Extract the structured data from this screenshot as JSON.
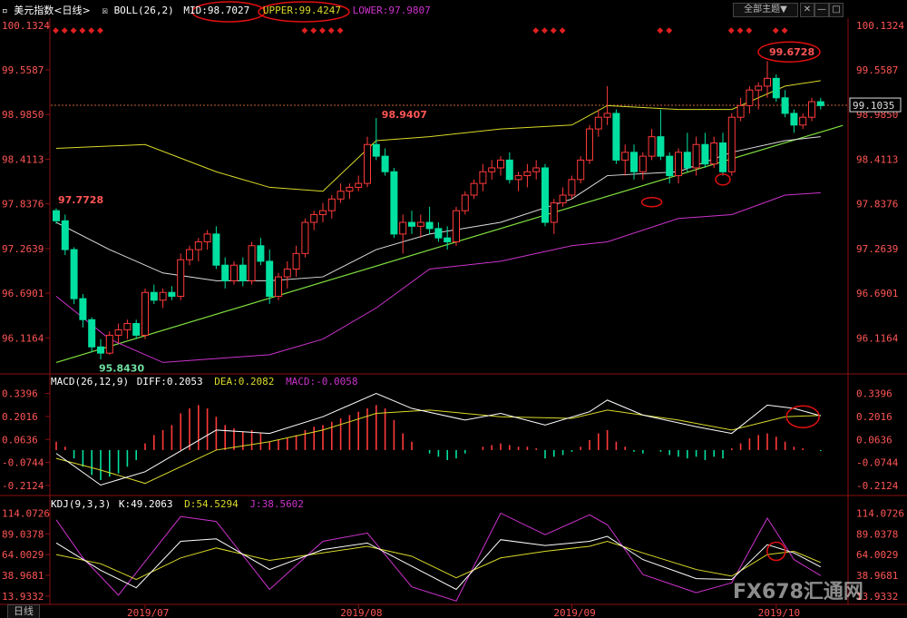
{
  "header": {
    "symbol_label": "美元指数<日线>",
    "boll_label": "BOLL(26,2)",
    "mid_label": "MID:98.7027",
    "upper_label": "UPPER:99.4247",
    "lower_label": "LOWER:97.9807",
    "theme_select": "全部主题▼",
    "theme_options": [
      "全部主题"
    ]
  },
  "panels": {
    "macd_label": "MACD(26,12,9)",
    "macd_diff": "DIFF:0.2053",
    "macd_dea": "DEA:0.2082",
    "macd_macd": "MACD:-0.0058",
    "kdj_label": "KDJ(9,3,3)",
    "kdj_k": "K:49.2063",
    "kdj_d": "D:54.5294",
    "kdj_j": "J:38.5602"
  },
  "bottom_bar": {
    "period_tab": "日线"
  },
  "watermark": {
    "brand": "FX678汇通网"
  },
  "colors": {
    "up": "#ff3a3a",
    "down": "#00e0a0",
    "boll_upper": "#d9d92a",
    "boll_mid": "#dddddd",
    "boll_lower": "#cc33cc",
    "trendline": "#80e040",
    "axis": "#8b1010",
    "tick_text": "#ff5555",
    "price_line": "#c86432",
    "highlight_ellipse": "#e01010"
  },
  "chart_data": [
    {
      "type": "candlestick",
      "title": "美元指数<日线>",
      "y_ticks": [
        "100.1324",
        "99.5587",
        "98.9850",
        "98.4113",
        "97.8376",
        "97.2639",
        "96.6901",
        "96.1164"
      ],
      "ylim": [
        95.7,
        100.2
      ],
      "x_ticks": [
        "2019/07",
        "2019/08",
        "2019/09",
        "2019/10"
      ],
      "last_price": "99.1035",
      "candles": [
        [
          97.75,
          97.78,
          97.58,
          97.62
        ],
        [
          97.62,
          97.7,
          97.18,
          97.25
        ],
        [
          97.25,
          97.28,
          96.55,
          96.62
        ],
        [
          96.62,
          96.68,
          96.25,
          96.35
        ],
        [
          96.35,
          96.38,
          95.93,
          96.0
        ],
        [
          96.0,
          96.1,
          95.84,
          95.92
        ],
        [
          95.92,
          96.2,
          95.9,
          96.15
        ],
        [
          96.15,
          96.3,
          96.05,
          96.22
        ],
        [
          96.22,
          96.35,
          96.1,
          96.3
        ],
        [
          96.3,
          96.35,
          96.1,
          96.15
        ],
        [
          96.15,
          96.75,
          96.1,
          96.7
        ],
        [
          96.7,
          96.8,
          96.55,
          96.6
        ],
        [
          96.6,
          96.75,
          96.5,
          96.7
        ],
        [
          96.7,
          96.78,
          96.6,
          96.65
        ],
        [
          96.65,
          97.2,
          96.6,
          97.12
        ],
        [
          97.12,
          97.3,
          97.05,
          97.25
        ],
        [
          97.25,
          97.4,
          97.1,
          97.35
        ],
        [
          97.35,
          97.5,
          97.25,
          97.45
        ],
        [
          97.45,
          97.55,
          97.0,
          97.05
        ],
        [
          97.05,
          97.15,
          96.75,
          96.85
        ],
        [
          96.85,
          97.1,
          96.8,
          97.05
        ],
        [
          97.05,
          97.15,
          96.78,
          96.85
        ],
        [
          96.85,
          97.35,
          96.8,
          97.3
        ],
        [
          97.3,
          97.4,
          97.05,
          97.1
        ],
        [
          97.1,
          97.25,
          96.55,
          96.65
        ],
        [
          96.65,
          96.95,
          96.6,
          96.9
        ],
        [
          96.9,
          97.1,
          96.75,
          97.0
        ],
        [
          97.0,
          97.3,
          96.9,
          97.2
        ],
        [
          97.2,
          97.65,
          97.15,
          97.6
        ],
        [
          97.6,
          97.75,
          97.5,
          97.7
        ],
        [
          97.7,
          97.85,
          97.6,
          97.75
        ],
        [
          97.75,
          97.95,
          97.65,
          97.9
        ],
        [
          97.9,
          98.1,
          97.85,
          98.0
        ],
        [
          98.0,
          98.1,
          97.9,
          98.05
        ],
        [
          98.05,
          98.2,
          98.0,
          98.1
        ],
        [
          98.1,
          98.7,
          98.05,
          98.6
        ],
        [
          98.6,
          98.94,
          98.4,
          98.45
        ],
        [
          98.45,
          98.55,
          98.2,
          98.25
        ],
        [
          98.25,
          98.3,
          97.4,
          97.45
        ],
        [
          97.45,
          97.7,
          97.2,
          97.6
        ],
        [
          97.6,
          97.75,
          97.45,
          97.55
        ],
        [
          97.55,
          97.7,
          97.4,
          97.6
        ],
        [
          97.6,
          97.8,
          97.45,
          97.52
        ],
        [
          97.52,
          97.6,
          97.35,
          97.4
        ],
        [
          97.4,
          97.55,
          97.25,
          97.35
        ],
        [
          97.35,
          97.8,
          97.3,
          97.75
        ],
        [
          97.75,
          98.0,
          97.7,
          97.95
        ],
        [
          97.95,
          98.15,
          97.9,
          98.1
        ],
        [
          98.1,
          98.35,
          98.0,
          98.25
        ],
        [
          98.25,
          98.4,
          98.15,
          98.3
        ],
        [
          98.3,
          98.45,
          98.2,
          98.4
        ],
        [
          98.4,
          98.5,
          98.1,
          98.15
        ],
        [
          98.15,
          98.25,
          98.0,
          98.2
        ],
        [
          98.2,
          98.35,
          98.05,
          98.25
        ],
        [
          98.25,
          98.4,
          98.15,
          98.3
        ],
        [
          98.3,
          98.35,
          97.55,
          97.6
        ],
        [
          97.6,
          97.9,
          97.45,
          97.85
        ],
        [
          97.85,
          98.05,
          97.8,
          97.95
        ],
        [
          97.95,
          98.2,
          97.9,
          98.15
        ],
        [
          98.15,
          98.45,
          98.1,
          98.4
        ],
        [
          98.4,
          98.85,
          98.35,
          98.8
        ],
        [
          98.8,
          99.05,
          98.7,
          98.95
        ],
        [
          98.95,
          99.35,
          98.85,
          99.0
        ],
        [
          99.0,
          99.05,
          98.35,
          98.4
        ],
        [
          98.4,
          98.6,
          98.2,
          98.5
        ],
        [
          98.5,
          98.6,
          98.15,
          98.25
        ],
        [
          98.25,
          98.5,
          98.15,
          98.45
        ],
        [
          98.45,
          98.8,
          98.4,
          98.7
        ],
        [
          98.7,
          99.05,
          98.4,
          98.45
        ],
        [
          98.45,
          98.5,
          98.1,
          98.2
        ],
        [
          98.2,
          98.55,
          98.1,
          98.5
        ],
        [
          98.5,
          98.75,
          98.25,
          98.3
        ],
        [
          98.3,
          98.7,
          98.2,
          98.6
        ],
        [
          98.6,
          98.75,
          98.3,
          98.35
        ],
        [
          98.35,
          98.7,
          98.3,
          98.62
        ],
        [
          98.62,
          98.75,
          98.2,
          98.25
        ],
        [
          98.25,
          99.0,
          98.2,
          98.95
        ],
        [
          98.95,
          99.2,
          98.9,
          99.1
        ],
        [
          99.1,
          99.35,
          99.0,
          99.3
        ],
        [
          99.3,
          99.4,
          99.05,
          99.35
        ],
        [
          99.35,
          99.67,
          99.2,
          99.45
        ],
        [
          99.45,
          99.5,
          99.15,
          99.2
        ],
        [
          99.2,
          99.3,
          98.95,
          99.0
        ],
        [
          99.0,
          99.05,
          98.75,
          98.85
        ],
        [
          98.85,
          99.0,
          98.8,
          98.95
        ],
        [
          98.95,
          99.2,
          98.9,
          99.15
        ],
        [
          99.15,
          99.2,
          99.05,
          99.1
        ]
      ],
      "boll_upper": [
        [
          0,
          98.55
        ],
        [
          10,
          98.6
        ],
        [
          18,
          98.25
        ],
        [
          24,
          98.05
        ],
        [
          30,
          98.0
        ],
        [
          36,
          98.65
        ],
        [
          42,
          98.7
        ],
        [
          50,
          98.8
        ],
        [
          58,
          98.85
        ],
        [
          62,
          99.1
        ],
        [
          70,
          99.05
        ],
        [
          76,
          99.05
        ],
        [
          82,
          99.35
        ],
        [
          86,
          99.42
        ]
      ],
      "boll_mid": [
        [
          0,
          97.6
        ],
        [
          6,
          97.25
        ],
        [
          12,
          96.95
        ],
        [
          18,
          96.85
        ],
        [
          24,
          96.85
        ],
        [
          30,
          96.9
        ],
        [
          36,
          97.25
        ],
        [
          42,
          97.45
        ],
        [
          50,
          97.6
        ],
        [
          58,
          97.9
        ],
        [
          62,
          98.2
        ],
        [
          70,
          98.25
        ],
        [
          76,
          98.5
        ],
        [
          82,
          98.65
        ],
        [
          86,
          98.7
        ]
      ],
      "boll_lower": [
        [
          0,
          96.65
        ],
        [
          6,
          96.1
        ],
        [
          12,
          95.8
        ],
        [
          18,
          95.85
        ],
        [
          24,
          95.9
        ],
        [
          30,
          96.1
        ],
        [
          36,
          96.5
        ],
        [
          42,
          97.0
        ],
        [
          50,
          97.1
        ],
        [
          58,
          97.3
        ],
        [
          62,
          97.35
        ],
        [
          70,
          97.65
        ],
        [
          76,
          97.7
        ],
        [
          82,
          97.95
        ],
        [
          86,
          97.98
        ]
      ],
      "trendline": [
        [
          0,
          95.8
        ],
        [
          86,
          98.76
        ]
      ],
      "annotations": [
        {
          "text": "97.7728",
          "at": [
            0,
            97.7728
          ]
        },
        {
          "text": "95.8430",
          "at": [
            5,
            95.843
          ]
        },
        {
          "text": "98.9407",
          "at": [
            36,
            98.9407
          ]
        },
        {
          "text": "99.6728",
          "at": [
            80,
            99.6728
          ]
        }
      ],
      "signals_top": [
        0,
        1,
        2,
        3,
        4,
        5,
        28,
        29,
        30,
        31,
        32,
        54,
        55,
        56,
        57,
        68,
        69,
        76,
        77,
        78,
        81,
        82
      ]
    },
    {
      "type": "bar",
      "title": "MACD(26,12,9)",
      "y_ticks": [
        "0.3396",
        "0.2016",
        "0.0636",
        "-0.0744",
        "-0.2124"
      ],
      "ylim": [
        -0.24,
        0.37
      ],
      "histogram": [
        0.05,
        0.02,
        -0.05,
        -0.1,
        -0.15,
        -0.18,
        -0.16,
        -0.14,
        -0.1,
        -0.06,
        0.04,
        0.09,
        0.12,
        0.15,
        0.22,
        0.25,
        0.27,
        0.25,
        0.2,
        0.15,
        0.13,
        0.11,
        0.12,
        0.1,
        0.05,
        0.06,
        0.07,
        0.09,
        0.12,
        0.14,
        0.15,
        0.17,
        0.19,
        0.21,
        0.23,
        0.25,
        0.27,
        0.25,
        0.18,
        0.1,
        0.05,
        0.0,
        -0.02,
        -0.04,
        -0.06,
        -0.05,
        -0.02,
        0.0,
        0.02,
        0.03,
        0.04,
        0.03,
        0.02,
        0.02,
        0.01,
        -0.05,
        -0.04,
        -0.03,
        -0.01,
        0.02,
        0.06,
        0.1,
        0.12,
        0.05,
        0.02,
        -0.01,
        -0.02,
        0.0,
        -0.01,
        -0.03,
        -0.04,
        -0.05,
        -0.04,
        -0.06,
        -0.04,
        -0.05,
        0.01,
        0.04,
        0.07,
        0.09,
        0.1,
        0.08,
        0.05,
        0.02,
        0.01,
        0.0,
        -0.006
      ],
      "diff": [
        [
          0,
          -0.02
        ],
        [
          5,
          -0.21
        ],
        [
          10,
          -0.13
        ],
        [
          18,
          0.12
        ],
        [
          24,
          0.1
        ],
        [
          30,
          0.2
        ],
        [
          36,
          0.34
        ],
        [
          40,
          0.25
        ],
        [
          46,
          0.18
        ],
        [
          50,
          0.22
        ],
        [
          55,
          0.15
        ],
        [
          60,
          0.23
        ],
        [
          62,
          0.3
        ],
        [
          66,
          0.21
        ],
        [
          72,
          0.14
        ],
        [
          76,
          0.1
        ],
        [
          80,
          0.27
        ],
        [
          83,
          0.25
        ],
        [
          86,
          0.2053
        ]
      ],
      "dea": [
        [
          0,
          -0.05
        ],
        [
          5,
          -0.12
        ],
        [
          10,
          -0.2
        ],
        [
          18,
          0.0
        ],
        [
          24,
          0.05
        ],
        [
          30,
          0.12
        ],
        [
          36,
          0.22
        ],
        [
          42,
          0.24
        ],
        [
          50,
          0.2
        ],
        [
          58,
          0.19
        ],
        [
          62,
          0.24
        ],
        [
          70,
          0.18
        ],
        [
          76,
          0.12
        ],
        [
          82,
          0.2
        ],
        [
          86,
          0.2082
        ]
      ]
    },
    {
      "type": "line",
      "title": "KDJ(9,3,3)",
      "y_ticks": [
        "114.0726",
        "89.0378",
        "64.0029",
        "38.9681",
        "13.9332"
      ],
      "ylim": [
        5,
        120
      ],
      "k": [
        [
          0,
          78
        ],
        [
          5,
          45
        ],
        [
          9,
          24
        ],
        [
          14,
          80
        ],
        [
          18,
          83
        ],
        [
          24,
          46
        ],
        [
          30,
          70
        ],
        [
          35,
          78
        ],
        [
          40,
          50
        ],
        [
          45,
          22
        ],
        [
          50,
          82
        ],
        [
          55,
          75
        ],
        [
          60,
          80
        ],
        [
          62,
          86
        ],
        [
          66,
          58
        ],
        [
          72,
          35
        ],
        [
          76,
          34
        ],
        [
          80,
          76
        ],
        [
          83,
          66
        ],
        [
          86,
          49.2
        ]
      ],
      "d": [
        [
          0,
          64
        ],
        [
          5,
          53
        ],
        [
          9,
          34
        ],
        [
          14,
          60
        ],
        [
          18,
          72
        ],
        [
          24,
          57
        ],
        [
          30,
          66
        ],
        [
          35,
          74
        ],
        [
          40,
          62
        ],
        [
          45,
          36
        ],
        [
          50,
          60
        ],
        [
          55,
          68
        ],
        [
          60,
          74
        ],
        [
          62,
          80
        ],
        [
          66,
          66
        ],
        [
          72,
          46
        ],
        [
          76,
          38
        ],
        [
          80,
          64
        ],
        [
          83,
          68
        ],
        [
          86,
          54.5
        ]
      ],
      "j": [
        [
          0,
          106
        ],
        [
          3,
          60
        ],
        [
          7,
          15
        ],
        [
          14,
          110
        ],
        [
          18,
          104
        ],
        [
          24,
          22
        ],
        [
          30,
          80
        ],
        [
          35,
          90
        ],
        [
          40,
          25
        ],
        [
          45,
          8
        ],
        [
          50,
          114
        ],
        [
          55,
          88
        ],
        [
          60,
          112
        ],
        [
          62,
          100
        ],
        [
          66,
          40
        ],
        [
          72,
          18
        ],
        [
          76,
          30
        ],
        [
          80,
          108
        ],
        [
          83,
          58
        ],
        [
          86,
          38.6
        ]
      ]
    }
  ]
}
